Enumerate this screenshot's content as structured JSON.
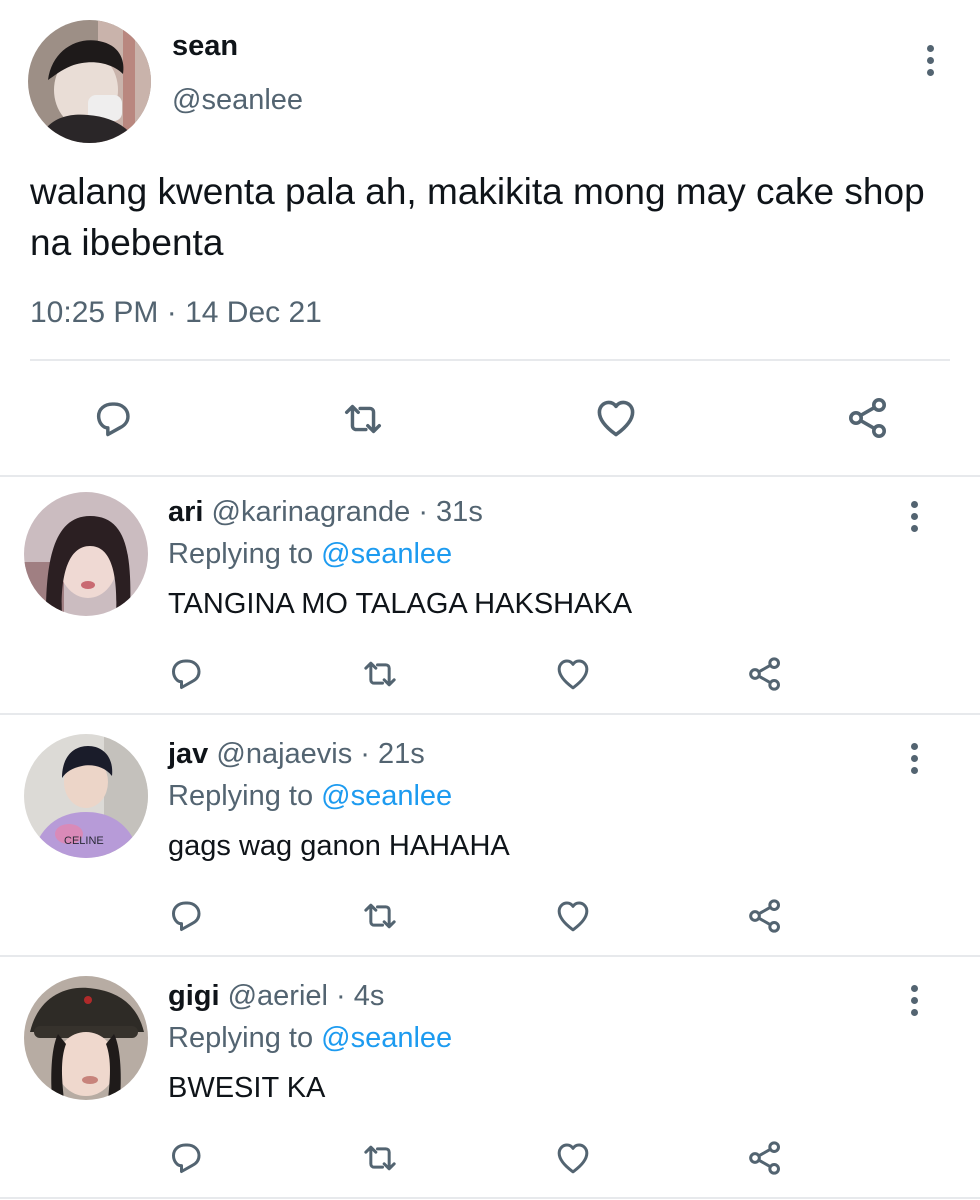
{
  "main_tweet": {
    "name": "sean",
    "handle": "@seanlee",
    "text": "walang kwenta pala ah, makikita mong may cake shop na ibebenta",
    "timestamp": "10:25 PM · 14 Dec 21",
    "icons": [
      "reply-icon",
      "retweet-icon",
      "like-icon",
      "share-icon",
      "more-icon"
    ]
  },
  "replies": [
    {
      "name": "ari",
      "handle": "@karinagrande",
      "time": "· 31s",
      "replying_prefix": "Replying to ",
      "replying_to": "@seanlee",
      "text": "TANGINA MO TALAGA HAKSHAKA"
    },
    {
      "name": "jav",
      "handle": "@najaevis",
      "time": "· 21s",
      "replying_prefix": "Replying to ",
      "replying_to": "@seanlee",
      "text": "gags wag ganon HAHAHA",
      "avatar_shirt_text": "CELINE"
    },
    {
      "name": "gigi",
      "handle": "@aeriel",
      "time": "· 4s",
      "replying_prefix": "Replying to ",
      "replying_to": "@seanlee",
      "text": "BWESIT KA"
    }
  ],
  "colors": {
    "text": "#0f1419",
    "secondary": "#536471",
    "mention": "#1d9bf0",
    "divider": "#e7e9ec"
  }
}
